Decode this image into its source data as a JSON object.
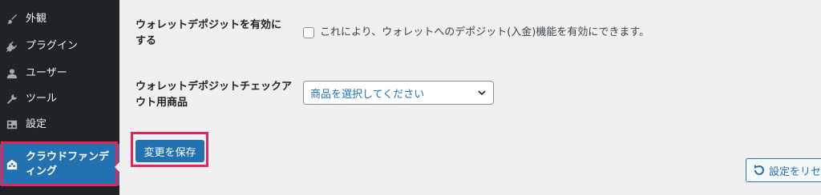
{
  "sidebar": {
    "items": [
      {
        "label": "外観",
        "icon": "paintbrush-icon"
      },
      {
        "label": "プラグイン",
        "icon": "plugin-icon"
      },
      {
        "label": "ユーザー",
        "icon": "user-icon"
      },
      {
        "label": "ツール",
        "icon": "wrench-icon"
      },
      {
        "label": "設定",
        "icon": "settings-icon"
      },
      {
        "label": "クラウドファンディング",
        "icon": "crowdfunding-icon"
      }
    ],
    "active_bg": "#2271b1",
    "bg": "#1d2327"
  },
  "form": {
    "deposit_enable": {
      "label": "ウォレットデポジットを有効にする",
      "description": "これにより、ウォレットへのデポジット(入金)機能を有効にできます。",
      "checked": false
    },
    "deposit_product": {
      "label": "ウォレットデポジットチェックアウト用商品",
      "selected": "商品を選択してください"
    },
    "save_label": "変更を保存",
    "reset_label": "設定をリセット"
  },
  "highlight_color": "#e6235b"
}
